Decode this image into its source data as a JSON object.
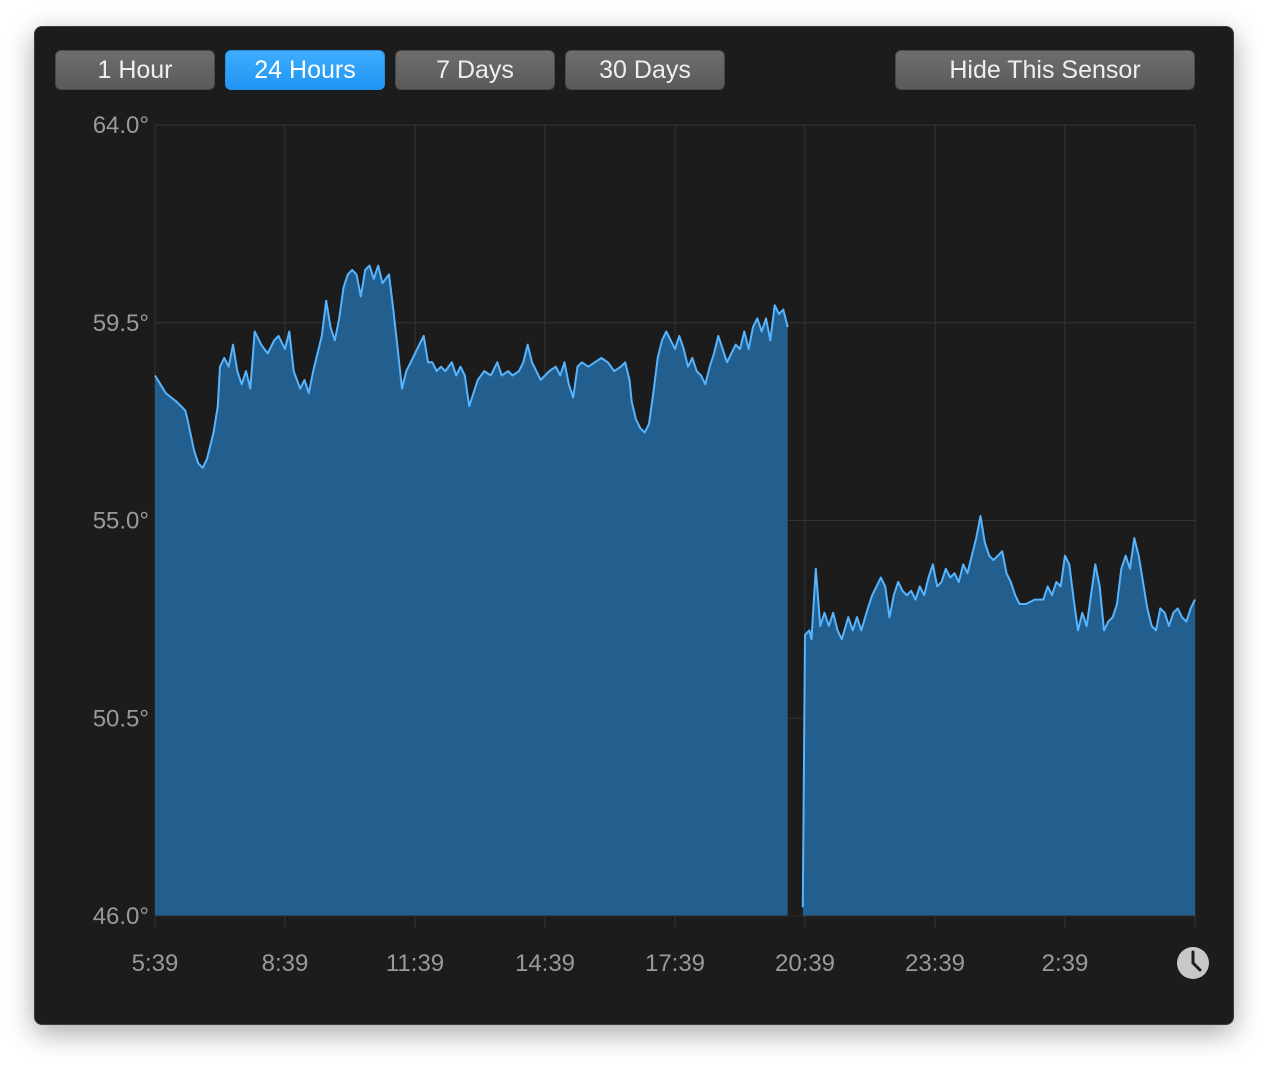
{
  "toolbar": {
    "buttons": [
      {
        "label": "1 Hour",
        "active": false
      },
      {
        "label": "24 Hours",
        "active": true
      },
      {
        "label": "7 Days",
        "active": false
      },
      {
        "label": "30 Days",
        "active": false
      }
    ],
    "hide_label": "Hide This Sensor"
  },
  "colors": {
    "window_bg": "#1c1c1c",
    "area_fill": "#225e8e",
    "line": "#57b4ff",
    "grid": "#333333",
    "active_button": "#2d9ffa",
    "button": "#636363"
  },
  "icons": {
    "clock": "clock-icon"
  },
  "chart_data": {
    "type": "area",
    "ylim": [
      46.0,
      64.0
    ],
    "y_ticks": [
      "64.0°",
      "59.5°",
      "55.0°",
      "50.5°",
      "46.0°"
    ],
    "y_tick_values": [
      64.0,
      59.5,
      55.0,
      50.5,
      46.0
    ],
    "x_ticks": [
      "5:39",
      "8:39",
      "11:39",
      "14:39",
      "17:39",
      "20:39",
      "23:39",
      "2:39"
    ],
    "x_unit": "hours since 5:39",
    "xlim": [
      0,
      24
    ],
    "grid": true,
    "series": [
      {
        "segments": [
          [
            [
              0.0,
              58.3
            ],
            [
              0.25,
              57.9
            ],
            [
              0.5,
              57.7
            ],
            [
              0.6,
              57.6
            ],
            [
              0.7,
              57.5
            ],
            [
              0.75,
              57.3
            ],
            [
              0.9,
              56.6
            ],
            [
              1.0,
              56.3
            ],
            [
              1.1,
              56.2
            ],
            [
              1.2,
              56.4
            ],
            [
              1.35,
              57.0
            ],
            [
              1.45,
              57.6
            ],
            [
              1.5,
              58.5
            ],
            [
              1.6,
              58.7
            ],
            [
              1.7,
              58.5
            ],
            [
              1.8,
              59.0
            ],
            [
              1.9,
              58.4
            ],
            [
              2.0,
              58.1
            ],
            [
              2.1,
              58.4
            ],
            [
              2.2,
              58.0
            ],
            [
              2.3,
              59.3
            ],
            [
              2.45,
              59.0
            ],
            [
              2.6,
              58.8
            ],
            [
              2.75,
              59.1
            ],
            [
              2.85,
              59.2
            ],
            [
              3.0,
              58.9
            ],
            [
              3.1,
              59.3
            ],
            [
              3.2,
              58.4
            ],
            [
              3.35,
              58.0
            ],
            [
              3.45,
              58.2
            ],
            [
              3.55,
              57.9
            ],
            [
              3.65,
              58.4
            ],
            [
              3.75,
              58.8
            ],
            [
              3.85,
              59.2
            ],
            [
              3.95,
              60.0
            ],
            [
              4.05,
              59.4
            ],
            [
              4.15,
              59.1
            ],
            [
              4.25,
              59.6
            ],
            [
              4.35,
              60.3
            ],
            [
              4.45,
              60.6
            ],
            [
              4.55,
              60.7
            ],
            [
              4.65,
              60.6
            ],
            [
              4.75,
              60.1
            ],
            [
              4.85,
              60.7
            ],
            [
              4.95,
              60.8
            ],
            [
              5.05,
              60.5
            ],
            [
              5.15,
              60.8
            ],
            [
              5.25,
              60.4
            ],
            [
              5.4,
              60.6
            ],
            [
              5.5,
              59.8
            ],
            [
              5.6,
              58.9
            ],
            [
              5.7,
              58.0
            ],
            [
              5.8,
              58.4
            ],
            [
              5.9,
              58.6
            ],
            [
              6.0,
              58.8
            ],
            [
              6.1,
              59.0
            ],
            [
              6.2,
              59.2
            ],
            [
              6.3,
              58.6
            ],
            [
              6.4,
              58.6
            ],
            [
              6.5,
              58.4
            ],
            [
              6.6,
              58.5
            ],
            [
              6.7,
              58.4
            ],
            [
              6.85,
              58.6
            ],
            [
              6.95,
              58.3
            ],
            [
              7.05,
              58.5
            ],
            [
              7.15,
              58.3
            ],
            [
              7.25,
              57.6
            ],
            [
              7.35,
              57.9
            ],
            [
              7.45,
              58.2
            ],
            [
              7.6,
              58.4
            ],
            [
              7.75,
              58.3
            ],
            [
              7.9,
              58.6
            ],
            [
              8.0,
              58.3
            ],
            [
              8.15,
              58.4
            ],
            [
              8.25,
              58.3
            ],
            [
              8.4,
              58.4
            ],
            [
              8.5,
              58.6
            ],
            [
              8.6,
              59.0
            ],
            [
              8.7,
              58.6
            ],
            [
              8.8,
              58.4
            ],
            [
              8.9,
              58.2
            ],
            [
              9.0,
              58.3
            ],
            [
              9.1,
              58.4
            ],
            [
              9.25,
              58.5
            ],
            [
              9.35,
              58.3
            ],
            [
              9.45,
              58.6
            ],
            [
              9.55,
              58.1
            ],
            [
              9.65,
              57.8
            ],
            [
              9.75,
              58.5
            ],
            [
              9.85,
              58.6
            ],
            [
              10.0,
              58.5
            ],
            [
              10.15,
              58.6
            ],
            [
              10.3,
              58.7
            ],
            [
              10.45,
              58.6
            ],
            [
              10.6,
              58.4
            ],
            [
              10.75,
              58.5
            ],
            [
              10.85,
              58.6
            ],
            [
              10.95,
              58.2
            ],
            [
              11.0,
              57.7
            ],
            [
              11.1,
              57.3
            ],
            [
              11.2,
              57.1
            ],
            [
              11.3,
              57.0
            ],
            [
              11.4,
              57.2
            ],
            [
              11.5,
              57.9
            ],
            [
              11.6,
              58.7
            ],
            [
              11.7,
              59.1
            ],
            [
              11.8,
              59.3
            ],
            [
              11.9,
              59.1
            ],
            [
              12.0,
              58.9
            ],
            [
              12.1,
              59.2
            ],
            [
              12.2,
              58.9
            ],
            [
              12.3,
              58.5
            ],
            [
              12.4,
              58.7
            ],
            [
              12.5,
              58.4
            ],
            [
              12.6,
              58.3
            ],
            [
              12.7,
              58.1
            ],
            [
              12.8,
              58.5
            ],
            [
              12.9,
              58.8
            ],
            [
              13.0,
              59.2
            ],
            [
              13.1,
              58.9
            ],
            [
              13.2,
              58.6
            ],
            [
              13.3,
              58.8
            ],
            [
              13.4,
              59.0
            ],
            [
              13.5,
              58.9
            ],
            [
              13.6,
              59.3
            ],
            [
              13.7,
              58.9
            ],
            [
              13.8,
              59.4
            ],
            [
              13.9,
              59.6
            ],
            [
              14.0,
              59.3
            ],
            [
              14.1,
              59.6
            ],
            [
              14.2,
              59.1
            ],
            [
              14.3,
              59.9
            ],
            [
              14.4,
              59.7
            ],
            [
              14.5,
              59.8
            ],
            [
              14.55,
              59.6
            ],
            [
              14.6,
              59.4
            ]
          ],
          [
            [
              14.95,
              46.2
            ],
            [
              15.0,
              52.4
            ],
            [
              15.1,
              52.5
            ],
            [
              15.15,
              52.3
            ],
            [
              15.25,
              53.9
            ],
            [
              15.35,
              52.6
            ],
            [
              15.45,
              52.9
            ],
            [
              15.55,
              52.6
            ],
            [
              15.65,
              52.9
            ],
            [
              15.75,
              52.5
            ],
            [
              15.85,
              52.3
            ],
            [
              16.0,
              52.8
            ],
            [
              16.1,
              52.5
            ],
            [
              16.2,
              52.8
            ],
            [
              16.3,
              52.5
            ],
            [
              16.45,
              53.0
            ],
            [
              16.55,
              53.3
            ],
            [
              16.65,
              53.5
            ],
            [
              16.75,
              53.7
            ],
            [
              16.85,
              53.5
            ],
            [
              16.95,
              52.8
            ],
            [
              17.05,
              53.3
            ],
            [
              17.15,
              53.6
            ],
            [
              17.25,
              53.4
            ],
            [
              17.35,
              53.3
            ],
            [
              17.45,
              53.4
            ],
            [
              17.55,
              53.2
            ],
            [
              17.65,
              53.5
            ],
            [
              17.75,
              53.3
            ],
            [
              17.85,
              53.7
            ],
            [
              17.95,
              54.0
            ],
            [
              18.05,
              53.5
            ],
            [
              18.15,
              53.6
            ],
            [
              18.25,
              53.9
            ],
            [
              18.35,
              53.7
            ],
            [
              18.45,
              53.8
            ],
            [
              18.55,
              53.6
            ],
            [
              18.65,
              54.0
            ],
            [
              18.75,
              53.8
            ],
            [
              18.85,
              54.2
            ],
            [
              18.95,
              54.6
            ],
            [
              19.05,
              55.1
            ],
            [
              19.15,
              54.5
            ],
            [
              19.25,
              54.2
            ],
            [
              19.35,
              54.1
            ],
            [
              19.45,
              54.2
            ],
            [
              19.55,
              54.3
            ],
            [
              19.65,
              53.8
            ],
            [
              19.75,
              53.6
            ],
            [
              19.85,
              53.3
            ],
            [
              19.95,
              53.1
            ],
            [
              20.1,
              53.1
            ],
            [
              20.3,
              53.2
            ],
            [
              20.5,
              53.2
            ],
            [
              20.6,
              53.5
            ],
            [
              20.7,
              53.3
            ],
            [
              20.8,
              53.6
            ],
            [
              20.9,
              53.5
            ],
            [
              21.0,
              54.2
            ],
            [
              21.1,
              54.0
            ],
            [
              21.2,
              53.2
            ],
            [
              21.3,
              52.5
            ],
            [
              21.4,
              52.9
            ],
            [
              21.5,
              52.6
            ],
            [
              21.6,
              53.3
            ],
            [
              21.7,
              54.0
            ],
            [
              21.8,
              53.5
            ],
            [
              21.9,
              52.5
            ],
            [
              22.0,
              52.7
            ],
            [
              22.1,
              52.8
            ],
            [
              22.2,
              53.1
            ],
            [
              22.3,
              53.9
            ],
            [
              22.4,
              54.2
            ],
            [
              22.5,
              53.9
            ],
            [
              22.6,
              54.6
            ],
            [
              22.7,
              54.2
            ],
            [
              22.8,
              53.6
            ],
            [
              22.9,
              53.0
            ],
            [
              23.0,
              52.6
            ],
            [
              23.1,
              52.5
            ],
            [
              23.2,
              53.0
            ],
            [
              23.3,
              52.9
            ],
            [
              23.4,
              52.6
            ],
            [
              23.5,
              52.9
            ],
            [
              23.6,
              53.0
            ],
            [
              23.7,
              52.8
            ],
            [
              23.8,
              52.7
            ],
            [
              23.9,
              53.0
            ],
            [
              24.0,
              53.2
            ]
          ]
        ]
      }
    ]
  }
}
